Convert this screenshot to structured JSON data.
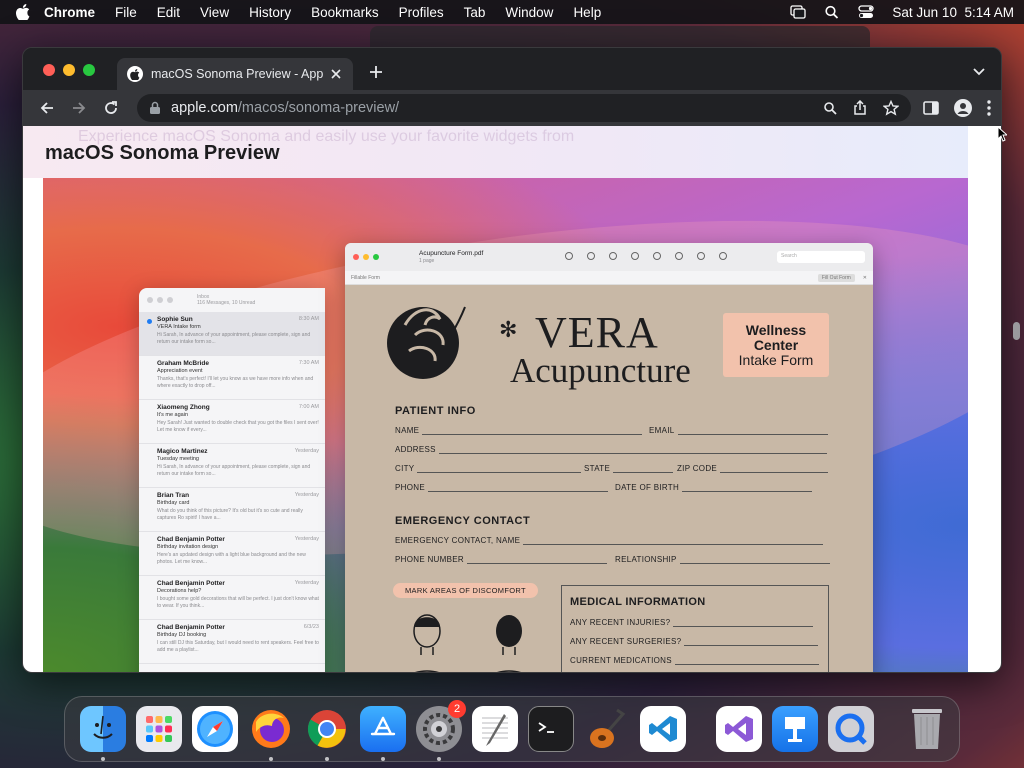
{
  "menubar": {
    "app_name": "Chrome",
    "items": [
      "File",
      "Edit",
      "View",
      "History",
      "Bookmarks",
      "Profiles",
      "Tab",
      "Window",
      "Help"
    ],
    "datetime": "Sat Jun 10  5:14 AM"
  },
  "browser": {
    "tab_title": "macOS Sonoma Preview - Appl",
    "url_host": "apple.com",
    "url_path": "/macos/sonoma-preview/"
  },
  "page": {
    "title": "macOS Sonoma Preview",
    "ghost_text": "Experience  macOS Sonoma and easily use your favorite widgets from"
  },
  "mail": {
    "header": "Inbox",
    "subheader": "116 Messages, 10 Unread",
    "items": [
      {
        "from": "Sophie Sun",
        "time": "8:30 AM",
        "subject": "VERA Intake form",
        "preview": "Hi Sarah, In advance of your appointment, please complete, sign and return our intake form so..."
      },
      {
        "from": "Graham McBride",
        "time": "7:30 AM",
        "subject": "Appreciation event",
        "preview": "Thanks, that's perfect! I'll let you know as we have more info when and where exactly to drop off..."
      },
      {
        "from": "Xiaomeng Zhong",
        "time": "7:00 AM",
        "subject": "It's me again",
        "preview": "Hey Sarah! Just wanted to double check that you got the files I sent over! Let me know if every..."
      },
      {
        "from": "Magico Martinez",
        "time": "Yesterday",
        "subject": "Tuesday meeting",
        "preview": "Hi Sarah, In advance of your appointment, please complete, sign and return our intake form so..."
      },
      {
        "from": "Brian Tran",
        "time": "Yesterday",
        "subject": "Birthday card",
        "preview": "What do you think of this picture? It's old but it's so cute and really captures Ro spirit! I have a..."
      },
      {
        "from": "Chad Benjamin Potter",
        "time": "Yesterday",
        "subject": "Birthday invitation design",
        "preview": "Here's an updated design with a light blue background and the new photos. Let me know..."
      },
      {
        "from": "Chad Benjamin Potter",
        "time": "Yesterday",
        "subject": "Decorations help?",
        "preview": "I bought some gold decorations that will be perfect. I just don't know what to wear. If you think..."
      },
      {
        "from": "Chad Benjamin Potter",
        "time": "6/3/23",
        "subject": "Birthday DJ booking",
        "preview": "I can still DJ this Saturday, but I would need to rent speakers. Feel free to add me a playlist..."
      }
    ]
  },
  "pdf": {
    "filename": "Acupuncture Form.pdf",
    "pages": "1 page",
    "search_placeholder": "Search",
    "subbar_label": "Fillable Form",
    "fill_out": "Fill Out Form",
    "brand_name": "VERA",
    "brand_sub": "Acupuncture",
    "badge_line1": "Wellness",
    "badge_line2": "Center",
    "badge_line3": "Intake Form",
    "patient_info": "PATIENT INFO",
    "name": "NAME",
    "email": "EMAIL",
    "address": "ADDRESS",
    "city": "CITY",
    "state": "STATE",
    "zip": "ZIP CODE",
    "phone": "PHONE",
    "dob": "DATE OF BIRTH",
    "emergency": "EMERGENCY CONTACT",
    "emergency_name": "EMERGENCY CONTACT, NAME",
    "phone_number": "PHONE NUMBER",
    "relationship": "RELATIONSHIP",
    "discomfort": "MARK AREAS OF DISCOMFORT",
    "medical_info": "MEDICAL INFORMATION",
    "injuries": "ANY RECENT INJURIES?",
    "surgeries": "ANY RECENT SURGERIES?",
    "medications": "CURRENT MEDICATIONS"
  },
  "dock": {
    "apps": [
      "Finder",
      "Launchpad",
      "Safari",
      "Firefox",
      "Chrome",
      "App Store",
      "System Settings",
      "TextEdit",
      "Terminal",
      "GarageBand",
      "Visual Studio Code",
      "Visual Studio",
      "Keynote",
      "QuickTime Player",
      "Trash"
    ],
    "settings_badge": "2"
  },
  "colors": {
    "accent": "#1f7cf2",
    "form_bg": "#c8b8a6",
    "badge_bg": "#f2c2ac",
    "chrome_dark": "#202124"
  }
}
